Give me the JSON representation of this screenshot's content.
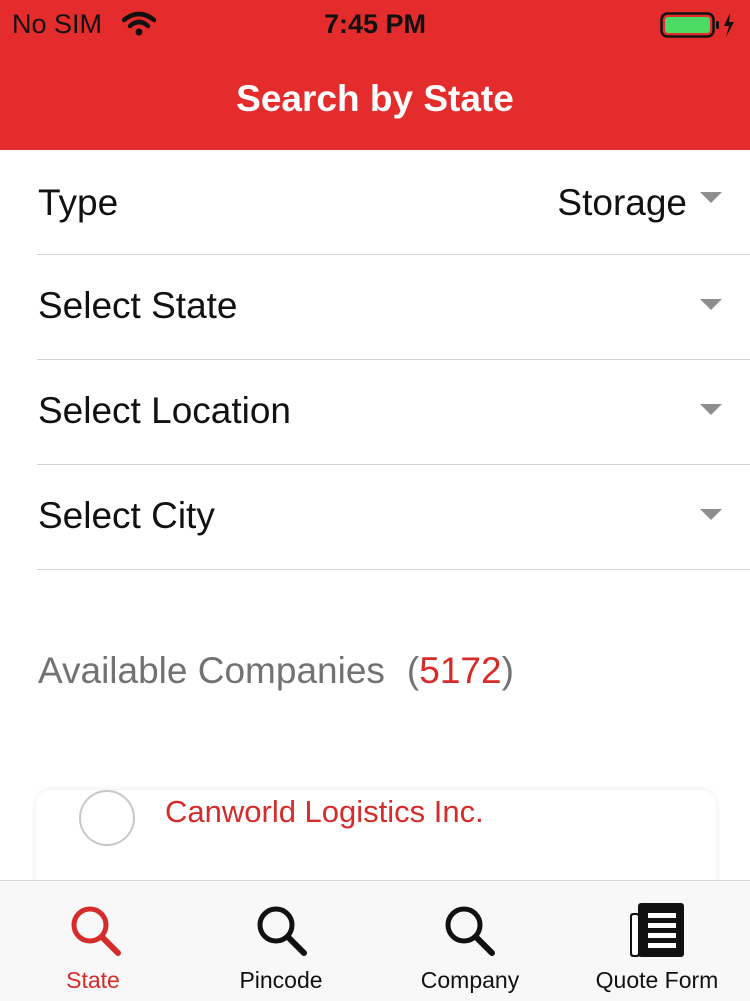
{
  "status_bar": {
    "carrier": "No SIM",
    "time": "7:45 PM"
  },
  "nav": {
    "title": "Search by State"
  },
  "form": {
    "type": {
      "label": "Type",
      "value": "Storage"
    },
    "state": {
      "label": "Select State"
    },
    "location": {
      "label": "Select Location"
    },
    "city": {
      "label": "Select City"
    }
  },
  "companies": {
    "heading": "Available Companies",
    "count_open": "(",
    "count": "5172",
    "count_close": ")",
    "items": [
      {
        "name": "Canworld Logistics Inc."
      }
    ]
  },
  "tab_bar": {
    "tabs": [
      {
        "label": "State",
        "icon": "search-icon",
        "active": true
      },
      {
        "label": "Pincode",
        "icon": "search-icon"
      },
      {
        "label": "Company",
        "icon": "search-icon"
      },
      {
        "label": "Quote Form",
        "icon": "document-icon"
      }
    ]
  },
  "colors": {
    "brand_red": "#e42c2c",
    "accent_red": "#d42b2b",
    "battery_green": "#4cd964"
  }
}
